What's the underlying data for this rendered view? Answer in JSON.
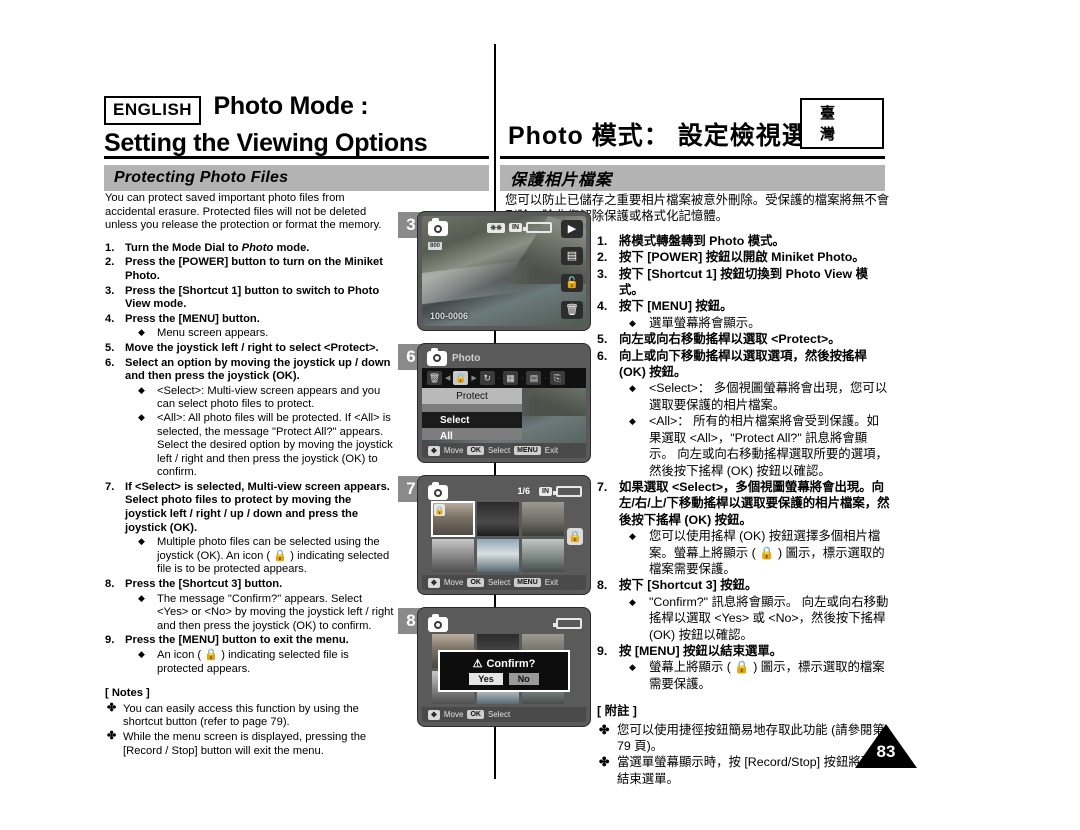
{
  "header": {
    "language_badge": "ENGLISH",
    "title_line1": "Photo Mode :",
    "title_line2": "Setting the Viewing Options",
    "title_zh": "Photo 模式： 設定檢視選項",
    "country_badge": "臺 灣"
  },
  "section": {
    "title_en": "Protecting Photo Files",
    "title_zh": "保護相片檔案"
  },
  "english": {
    "intro": "You can protect saved important photo files from accidental erasure. Protected files will not be deleted unless you release the protection or format the memory.",
    "steps": [
      {
        "num": "1.",
        "text": "Turn the Mode Dial to Photo mode.",
        "text_pre": "Turn the Mode Dial to ",
        "text_italic": "Photo",
        "text_post": " mode.",
        "bullets": []
      },
      {
        "num": "2.",
        "text": "Press the [POWER] button to turn on the Miniket Photo.",
        "bullets": []
      },
      {
        "num": "3.",
        "text": "Press the [Shortcut 1] button to switch to Photo View mode.",
        "bullets": []
      },
      {
        "num": "4.",
        "text": "Press the [MENU] button.",
        "bullets": [
          "Menu screen appears."
        ]
      },
      {
        "num": "5.",
        "text": "Move the joystick left / right to select <Protect>.",
        "bullets": []
      },
      {
        "num": "6.",
        "text": "Select an option by moving the joystick up / down and then press the joystick (OK).",
        "bullets": [
          "<Select>: Multi-view screen appears and you can select photo files to protect.",
          "<All>: All photo files will be protected. If <All> is selected, the message \"Protect All?\" appears. Select the desired option by moving the joystick left / right and then press the joystick (OK) to confirm."
        ]
      },
      {
        "num": "7.",
        "text": "If <Select> is selected, Multi-view screen appears. Select photo files to protect by moving the joystick left / right / up / down and press the joystick (OK).",
        "bullets": [
          "Multiple photo files can be selected using the joystick (OK). An icon ( 🔒 ) indicating selected file is to be protected appears."
        ]
      },
      {
        "num": "8.",
        "text": "Press the [Shortcut 3] button.",
        "bullets": [
          "The message \"Confirm?\" appears. Select <Yes> or <No> by moving the joystick left / right and then press the joystick (OK) to confirm."
        ]
      },
      {
        "num": "9.",
        "text": "Press the [MENU] button to exit the menu.",
        "bullets": [
          "An icon ( 🔒 ) indicating selected file is protected appears."
        ]
      }
    ],
    "notes_heading": "[ Notes ]",
    "notes": [
      "You can easily access this function by using the shortcut button (refer to page 79).",
      "While the menu screen is displayed, pressing the [Record / Stop] button will exit the menu."
    ]
  },
  "chinese": {
    "intro": "您可以防止已儲存之重要相片檔案被意外刪除。受保護的檔案將無不會刪除，除非您解除保護或格式化記憶體。",
    "steps": [
      {
        "num": "1.",
        "text": "將模式轉盤轉到 Photo 模式。",
        "bullets": []
      },
      {
        "num": "2.",
        "text": "按下 [POWER] 按鈕以開啟 Miniket Photo。",
        "bullets": []
      },
      {
        "num": "3.",
        "text": "按下 [Shortcut 1] 按鈕切換到 Photo View 模式。",
        "bullets": []
      },
      {
        "num": "4.",
        "text": "按下 [MENU] 按鈕。",
        "bullets": [
          "選單螢幕將會顯示。"
        ]
      },
      {
        "num": "5.",
        "text": "向左或向右移動搖桿以選取 <Protect>。",
        "bullets": []
      },
      {
        "num": "6.",
        "text": "向上或向下移動搖桿以選取選項，然後按搖桿 (OK) 按鈕。",
        "bullets": [
          "<Select>： 多個視圖螢幕將會出現，您可以選取要保護的相片檔案。",
          "<All>： 所有的相片檔案將會受到保護。如果選取 <All>，\"Protect All?\" 訊息將會顯示。 向左或向右移動搖桿選取所要的選項，然後按下搖桿 (OK) 按鈕以確認。"
        ]
      },
      {
        "num": "7.",
        "text": "如果選取 <Select>，多個視圖螢幕將會出現。向左/右/上/下移動搖桿以選取要保護的相片檔案，然後按下搖桿 (OK) 按鈕。",
        "bullets": [
          "您可以使用搖桿 (OK) 按鈕選擇多個相片檔案。螢幕上將顯示 ( 🔒 ) 圖示，標示選取的檔案需要保護。"
        ]
      },
      {
        "num": "8.",
        "text": "按下 [Shortcut 3] 按鈕。",
        "bullets": [
          "\"Confirm?\" 訊息將會顯示。 向左或向右移動搖桿以選取 <Yes> 或 <No>，然後按下搖桿 (OK) 按鈕以確認。"
        ]
      },
      {
        "num": "9.",
        "text": "按 [MENU] 按鈕以結束選單。",
        "bullets": [
          "螢幕上將顯示 ( 🔒 ) 圖示，標示選取的檔案需要保護。"
        ]
      }
    ],
    "notes_heading": "[ 附註 ]",
    "notes": [
      "您可以使用捷徑按鈕簡易地存取此功能 (請參閱第 79 頁)。",
      "當選單螢幕顯示時，按 [Record/Stop] 按鈕將可以結束選單。"
    ]
  },
  "figures": [
    {
      "step": "3",
      "type": "photo-view",
      "file_label": "100-0006",
      "res_badge": "800",
      "storage": "IN",
      "side_buttons": [
        "play-icon",
        "multiview-icon",
        "unlock-icon",
        "trash-icon"
      ]
    },
    {
      "step": "6",
      "type": "menu",
      "mode_label": "Photo",
      "selected_menu_label": "Protect",
      "menu_icons": [
        "trash-icon",
        "lock-icon",
        "rotate-icon",
        "slideshow-icon",
        "multiview-icon",
        "copy-icon"
      ],
      "options": [
        "Select",
        "All"
      ],
      "highlighted_option": "Select",
      "guide": [
        {
          "key": "joystick-icon",
          "label": "Move"
        },
        {
          "key": "OK",
          "label": "Select"
        },
        {
          "key": "MENU",
          "label": "Exit"
        }
      ]
    },
    {
      "step": "7",
      "type": "multi-view",
      "page_count": "1/6",
      "storage": "IN",
      "locked_thumb_index": 0,
      "selected_thumb_index": 4,
      "guide": [
        {
          "key": "joystick-icon",
          "label": "Move"
        },
        {
          "key": "OK",
          "label": "Select"
        },
        {
          "key": "MENU",
          "label": "Exit"
        }
      ]
    },
    {
      "step": "8",
      "type": "confirm-dialog",
      "dialog_title": "Confirm?",
      "buttons": [
        "Yes",
        "No"
      ],
      "default_button": "Yes",
      "guide": [
        {
          "key": "joystick-icon",
          "label": "Move"
        },
        {
          "key": "OK",
          "label": "Select"
        }
      ]
    }
  ],
  "page_number": "83"
}
